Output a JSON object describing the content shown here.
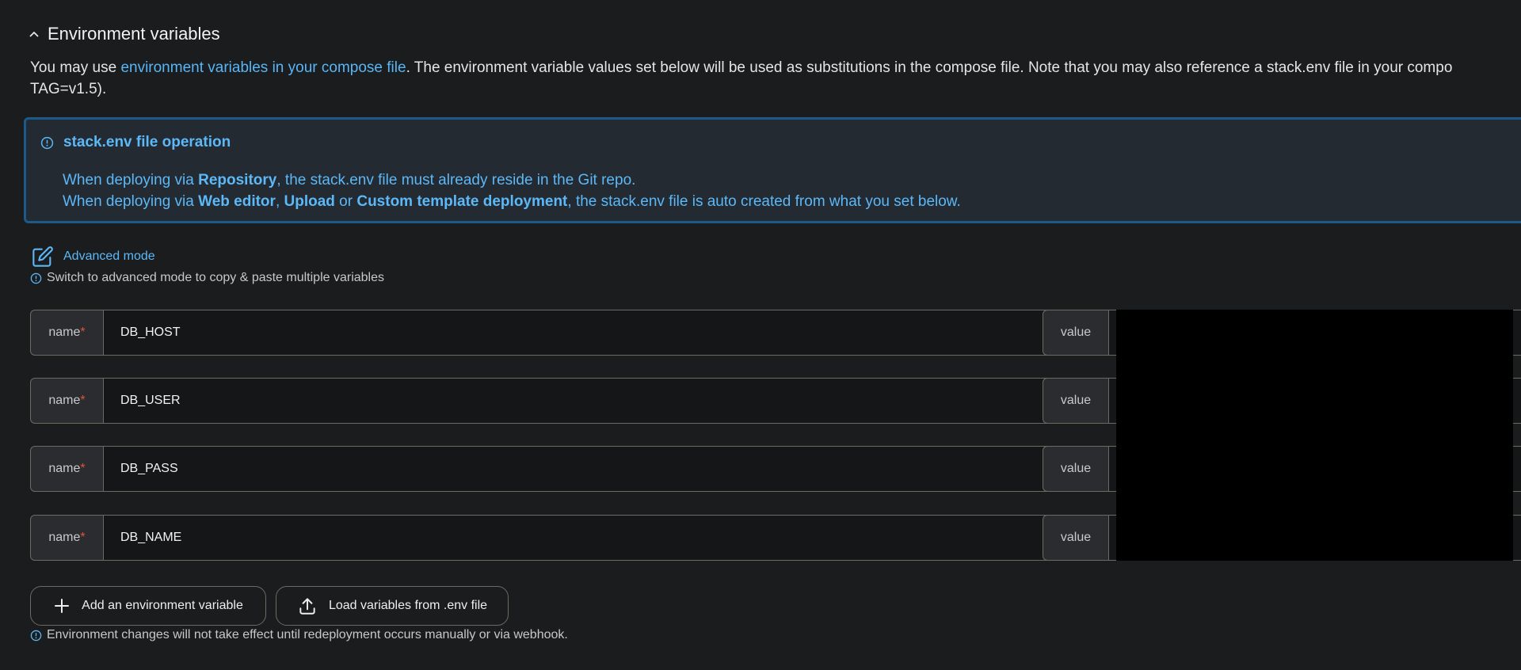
{
  "section": {
    "title": "Environment variables",
    "toggle_icon": "chevron-up-icon"
  },
  "description": {
    "prefix": "You may use ",
    "link": "environment variables in your compose file",
    "suffix": ". The environment variable values set below will be used as substitutions in the compose file. Note that you may also reference a stack.env file in your compo",
    "line2": "TAG=v1.5)."
  },
  "info_box": {
    "icon": "info-icon",
    "title": "stack.env file operation",
    "line1": {
      "a": "When deploying via ",
      "b": "Repository",
      "c": ", the stack.env file must already reside in the Git repo."
    },
    "line2": {
      "a": "When deploying via ",
      "b": "Web editor",
      "c": ", ",
      "d": "Upload",
      "e": " or ",
      "f": "Custom template deployment",
      "g": ", the stack.env file is auto created from what you set below."
    }
  },
  "advanced_mode": {
    "label": "Advanced mode",
    "icon": "edit-icon"
  },
  "advanced_hint": "Switch to advanced mode to copy & paste multiple variables",
  "name_label": "name",
  "required_mark": "*",
  "value_label": "value",
  "variables": [
    {
      "name": "DB_HOST"
    },
    {
      "name": "DB_USER"
    },
    {
      "name": "DB_PASS"
    },
    {
      "name": "DB_NAME"
    }
  ],
  "buttons": {
    "add": {
      "label": "Add an environment variable",
      "icon": "plus-icon"
    },
    "load": {
      "label": "Load variables from .env file",
      "icon": "upload-icon"
    }
  },
  "footer_hint": "Environment changes will not take effect until redeployment occurs manually or via webhook.",
  "colors": {
    "background": "#1b1c1e",
    "accent": "#5cb8f7",
    "info_border": "#1c5a8b",
    "required": "#e0513f"
  }
}
